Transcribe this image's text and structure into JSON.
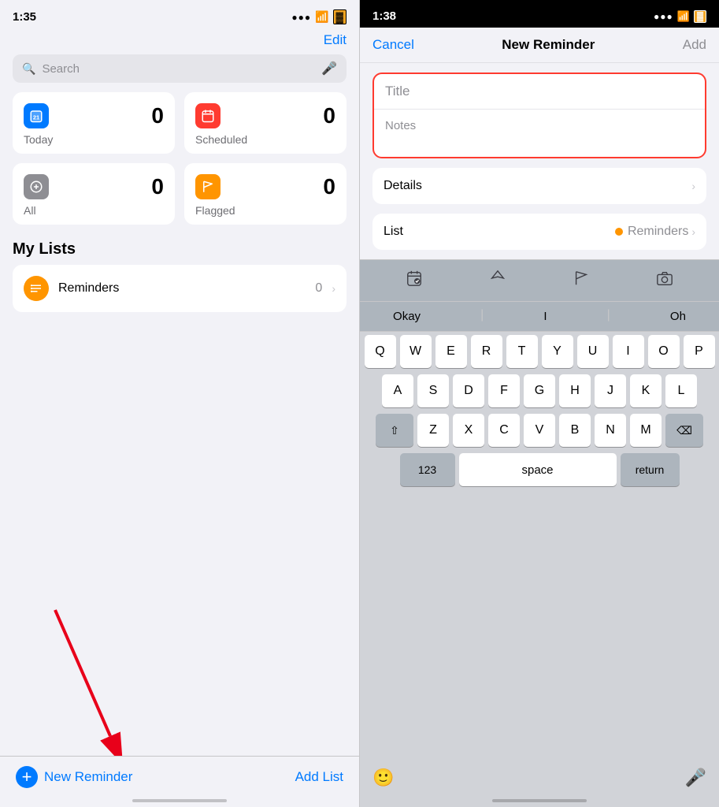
{
  "left": {
    "statusBar": {
      "time": "1:35",
      "locationIcon": "▶",
      "signal": "●●●",
      "wifi": "wifi",
      "battery": "battery"
    },
    "editButton": "Edit",
    "search": {
      "placeholder": "Search",
      "micIcon": "🎤"
    },
    "cards": [
      {
        "id": "today",
        "label": "Today",
        "count": "0",
        "iconColor": "#007aff",
        "iconType": "calendar"
      },
      {
        "id": "scheduled",
        "label": "Scheduled",
        "count": "0",
        "iconColor": "#ff3b30",
        "iconType": "calendar-grid"
      },
      {
        "id": "all",
        "label": "All",
        "count": "0",
        "iconColor": "#8e8e93",
        "iconType": "inbox"
      },
      {
        "id": "flagged",
        "label": "Flagged",
        "count": "0",
        "iconColor": "#ff9500",
        "iconType": "flag"
      }
    ],
    "myListsHeader": "My Lists",
    "lists": [
      {
        "name": "Reminders",
        "count": "0",
        "iconColor": "#ff9500"
      }
    ],
    "bottomBar": {
      "newReminderLabel": "New Reminder",
      "addListLabel": "Add List"
    }
  },
  "right": {
    "statusBar": {
      "time": "1:38",
      "locationIcon": "▶",
      "signal": "●●●",
      "wifi": "wifi",
      "battery": "battery"
    },
    "navBar": {
      "cancelLabel": "Cancel",
      "title": "New Reminder",
      "addLabel": "Add"
    },
    "form": {
      "titlePlaceholder": "Title",
      "notesPlaceholder": "Notes"
    },
    "detailsRow": {
      "label": "Details",
      "chevron": "›"
    },
    "listRow": {
      "label": "List",
      "listName": "Reminders",
      "chevron": "›"
    },
    "keyboard": {
      "toolbarIcons": [
        "📅",
        "✈",
        "🚩",
        "📷"
      ],
      "predictions": [
        "Okay",
        "I",
        "Oh"
      ],
      "rows": [
        [
          "Q",
          "W",
          "E",
          "R",
          "T",
          "Y",
          "U",
          "I",
          "O",
          "P"
        ],
        [
          "A",
          "S",
          "D",
          "F",
          "G",
          "H",
          "J",
          "K",
          "L"
        ],
        [
          "Z",
          "X",
          "C",
          "V",
          "B",
          "N",
          "M"
        ],
        [
          "123",
          "space",
          "return"
        ]
      ],
      "bottomIcons": [
        "emoji",
        "mic"
      ]
    }
  }
}
